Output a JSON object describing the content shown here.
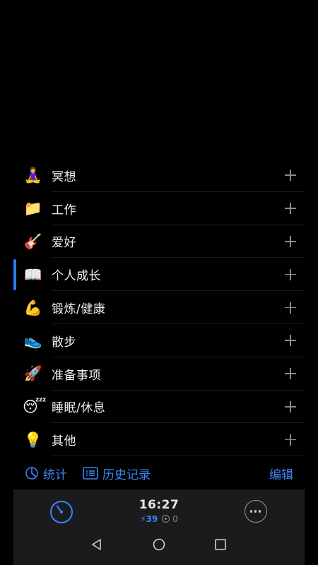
{
  "categories": [
    {
      "emoji": "🧘‍♀️",
      "icon": "meditation-icon",
      "label": "冥想",
      "selected": false
    },
    {
      "emoji": "📁",
      "icon": "folder-icon",
      "label": "工作",
      "selected": false
    },
    {
      "emoji": "🎸",
      "icon": "guitar-icon",
      "label": "爱好",
      "selected": false
    },
    {
      "emoji": "📖",
      "icon": "book-icon",
      "label": "个人成长",
      "selected": true
    },
    {
      "emoji": "💪",
      "icon": "flexed-biceps-icon",
      "label": "锻炼/健康",
      "selected": false
    },
    {
      "emoji": "👟",
      "icon": "running-shoe-icon",
      "label": "散步",
      "selected": false
    },
    {
      "emoji": "🚀",
      "icon": "rocket-icon",
      "label": "准备事项",
      "selected": false
    },
    {
      "emoji": "😴",
      "icon": "sleeping-face-icon",
      "label": "睡眠/休息",
      "selected": false
    },
    {
      "emoji": "💡",
      "icon": "light-bulb-icon",
      "label": "其他",
      "selected": false
    }
  ],
  "toolbar": {
    "stats_label": "统计",
    "history_label": "历史记录",
    "edit_label": "编辑"
  },
  "timer": {
    "time": "16:27",
    "energy_symbol": "⚡",
    "energy_value": "39",
    "points_value": "0"
  },
  "colors": {
    "accent": "#3a86f5",
    "background": "#000000",
    "panel": "#1b1b1d"
  }
}
